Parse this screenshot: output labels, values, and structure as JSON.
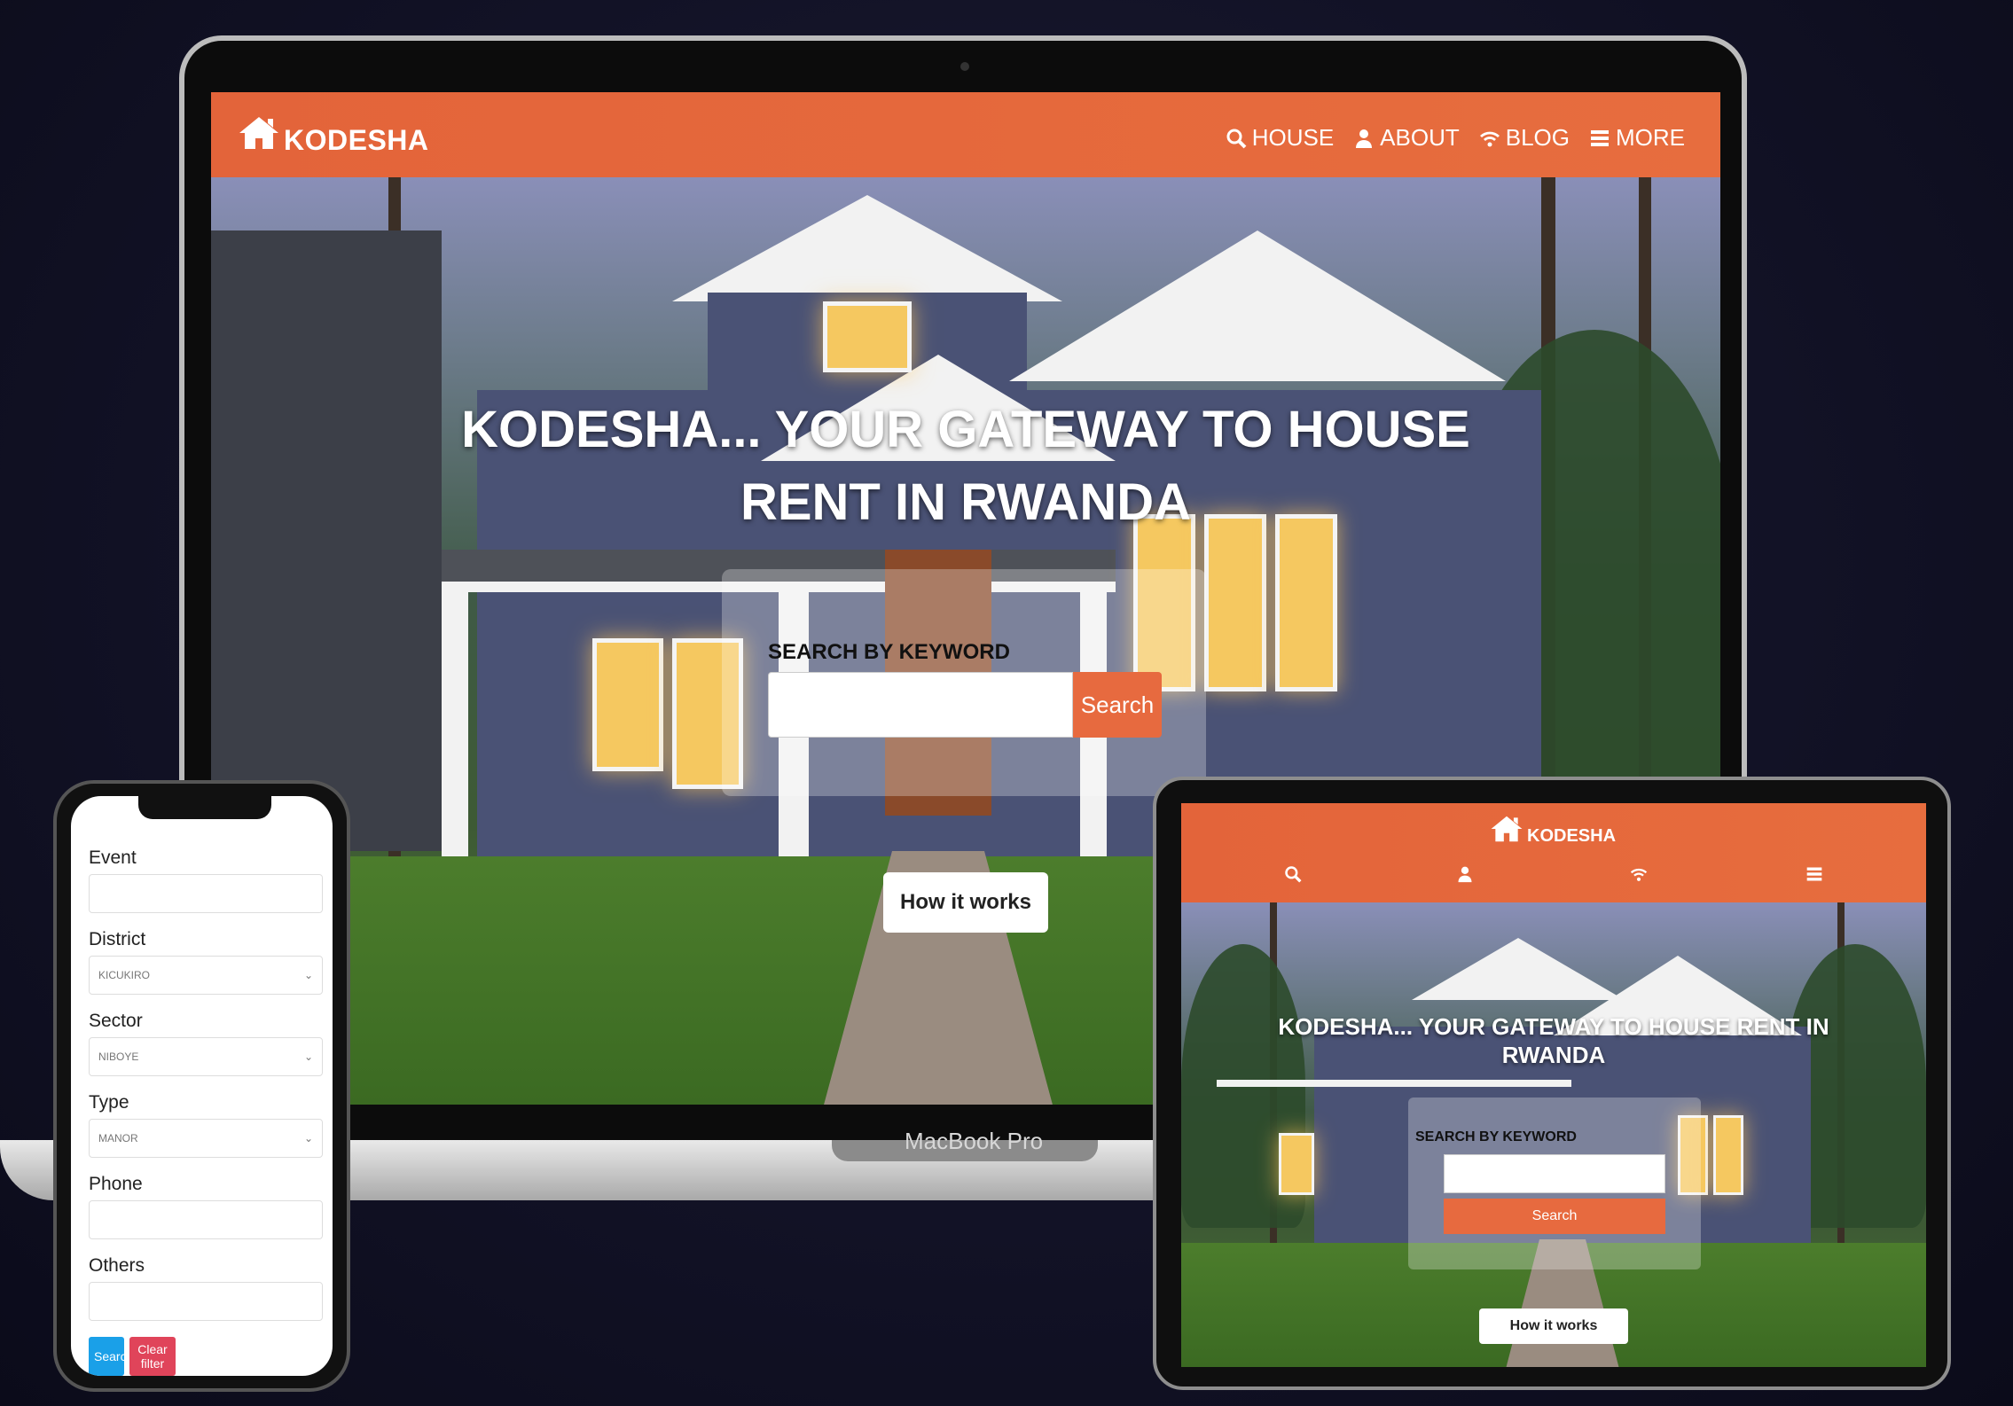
{
  "laptop": {
    "brand_text": "MacBook Pro",
    "logo_text": "KODESHA",
    "nav": [
      {
        "label": "HOUSE",
        "icon": "search-icon"
      },
      {
        "label": "ABOUT",
        "icon": "user-icon"
      },
      {
        "label": "BLOG",
        "icon": "wifi-icon"
      },
      {
        "label": "MORE",
        "icon": "menu-icon"
      }
    ],
    "hero_title": "KODESHA... YOUR GATEWAY TO HOUSE RENT IN RWANDA",
    "search_label": "SEARCH BY KEYWORD",
    "search_button": "Search",
    "how_button": "How it works"
  },
  "phone": {
    "fields": [
      {
        "label": "Event",
        "value": ""
      },
      {
        "label": "District",
        "value": "KICUKIRO"
      },
      {
        "label": "Sector",
        "value": "NIBOYE"
      },
      {
        "label": "Type",
        "value": "MANOR"
      },
      {
        "label": "Phone",
        "value": ""
      },
      {
        "label": "Others",
        "value": ""
      }
    ],
    "search_button": "Search",
    "clear_button": "Clear filter"
  },
  "tablet": {
    "logo_text": "KODESHA",
    "hero_title": "KODESHA... YOUR GATEWAY TO HOUSE RENT IN RWANDA",
    "search_label": "SEARCH BY KEYWORD",
    "search_button": "Search",
    "how_button": "How it works"
  },
  "colors": {
    "accent": "#e76a3f",
    "blue_button": "#1aa0e8",
    "red_button": "#e0445a"
  }
}
